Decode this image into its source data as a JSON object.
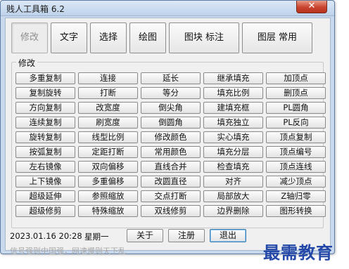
{
  "window": {
    "title": "贱人工具箱 6.2",
    "close_label": "✕"
  },
  "tabs": [
    {
      "label": "修改"
    },
    {
      "label": "文字"
    },
    {
      "label": "选择"
    },
    {
      "label": "绘图"
    },
    {
      "label": "图块 标注"
    },
    {
      "label": "图层 常用"
    }
  ],
  "active_tab": "修改",
  "group_title": "修改",
  "buttons": [
    "多重复制",
    "连接",
    "延长",
    "继承填充",
    "加顶点",
    "复制旋转",
    "打断",
    "等分",
    "填充比例",
    "删顶点",
    "方向复制",
    "改宽度",
    "倒尖角",
    "建填充框",
    "PL圆角",
    "连续复制",
    "刷宽度",
    "倒圆角",
    "填充独立",
    "PL反向",
    "旋转复制",
    "线型比例",
    "修改颜色",
    "实心填充",
    "顶点复制",
    "按弧复制",
    "定距打断",
    "常用颜色",
    "填充分层",
    "顶点编号",
    "左右镜像",
    "双向偏移",
    "直线合并",
    "检查填充",
    "顶点连线",
    "上下镜像",
    "多重偏移",
    "改圆直径",
    "对齐",
    "减少顶点",
    "超级延伸",
    "参照缩放",
    "交点打断",
    "局部放大",
    "Z轴归零",
    "超级修剪",
    "特殊缩放",
    "双线修剪",
    "边界删除",
    "图形转换"
  ],
  "footer": {
    "datetime": "2023.01.16 20:28",
    "weekday": "星期一",
    "about_label": "关于",
    "register_label": "注册",
    "exit_label": "退出",
    "status_text": "信号强则中国强，网速慢则天下乱"
  },
  "watermark": "最需教育",
  "colors": {
    "title_bg": "#c9d9ed",
    "close_red": "#c8442e",
    "watermark_blue": "#2448a8"
  }
}
